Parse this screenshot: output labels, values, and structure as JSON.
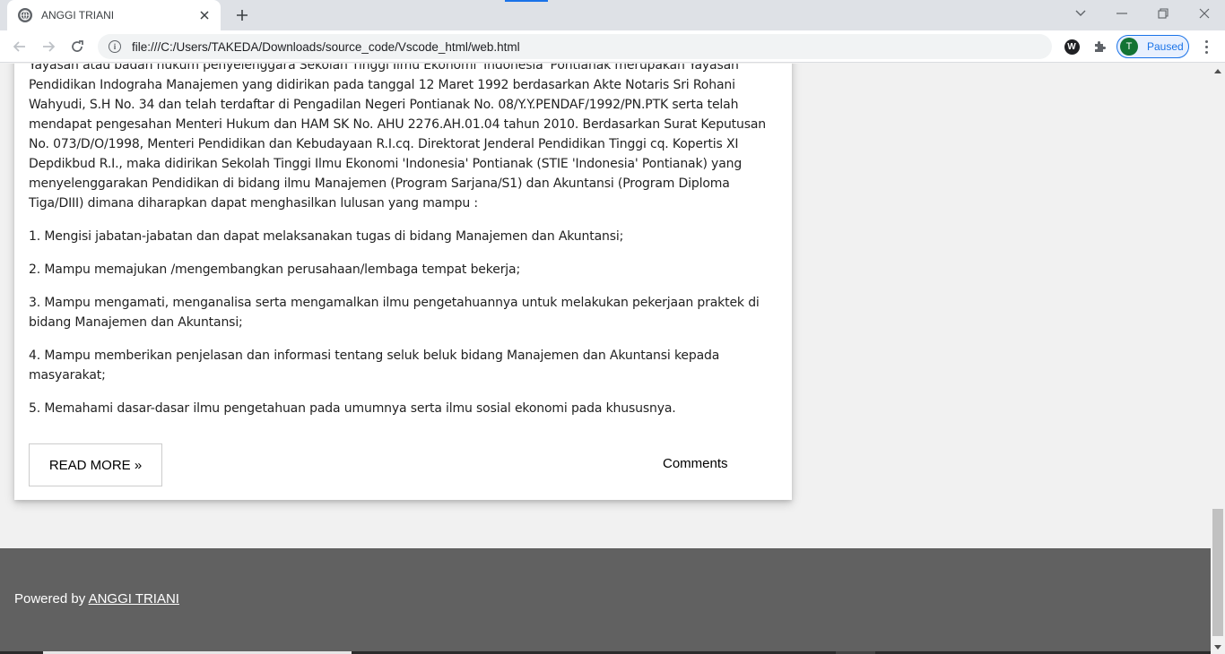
{
  "browser": {
    "tab_title": "ANGGI TRIANI",
    "url": "file:///C:/Users/TAKEDA/Downloads/source_code/Vscode_html/web.html",
    "profile_initial": "T",
    "profile_status": "Paused",
    "icons": {
      "favicon": "globe-icon",
      "close": "close-icon",
      "new_tab": "plus-icon",
      "back": "arrow-left-icon",
      "forward": "arrow-right-icon",
      "reload": "reload-icon",
      "site_info": "info-icon",
      "extension_w": "w-extension-icon",
      "extensions": "puzzle-icon",
      "menu": "kebab-menu-icon",
      "tab_search": "chevron-down-icon",
      "minimize": "minimize-icon",
      "restore": "restore-icon",
      "close_window": "close-window-icon"
    }
  },
  "article": {
    "intro": "Yayasan atau badan hukum penyelenggara Sekolah Tinggi Ilmu Ekonomi 'Indonesia' Pontianak merupakan Yayasan Pendidikan Indograha Manajemen yang didirikan pada tanggal 12 Maret 1992 berdasarkan Akte Notaris Sri Rohani Wahyudi, S.H No. 34 dan telah terdaftar di Pengadilan Negeri Pontianak No. 08/Y.Y.PENDAF/1992/PN.PTK serta telah mendapat pengesahan Menteri Hukum dan HAM SK No. AHU 2276.AH.01.04 tahun 2010. Berdasarkan Surat Keputusan No. 073/D/O/1998, Menteri Pendidikan dan Kebudayaan R.I.cq. Direktorat Jenderal Pendidikan Tinggi cq. Kopertis XI Depdikbud R.I., maka didirikan Sekolah Tinggi Ilmu Ekonomi 'Indonesia' Pontianak (STIE 'Indonesia' Pontianak) yang menyelenggarakan Pendidikan di bidang ilmu Manajemen (Program Sarjana/S1) dan Akuntansi (Program Diploma Tiga/DIII) dimana diharapkan dapat menghasilkan lulusan yang mampu :",
    "points": [
      "1. Mengisi jabatan-jabatan dan dapat melaksanakan tugas di bidang Manajemen dan Akuntansi;",
      "2. Mampu memajukan /mengembangkan perusahaan/lembaga tempat bekerja;",
      "3. Mampu mengamati, menganalisa serta mengamalkan ilmu pengetahuannya untuk melakukan pekerjaan praktek di bidang Manajemen dan Akuntansi;",
      "4. Mampu memberikan penjelasan dan informasi tentang seluk beluk bidang Manajemen dan Akuntansi kepada masyarakat;",
      "5. Memahami dasar-dasar ilmu pengetahuan pada umumnya serta ilmu sosial ekonomi pada khususnya."
    ],
    "read_more": "READ MORE »",
    "comments": "Comments"
  },
  "footer": {
    "powered_by": "Powered by",
    "author_link": "ANGGI TRIANI"
  },
  "colors": {
    "footer_bg": "#616161",
    "accent": "#1a73e8",
    "avatar": "#137333"
  }
}
